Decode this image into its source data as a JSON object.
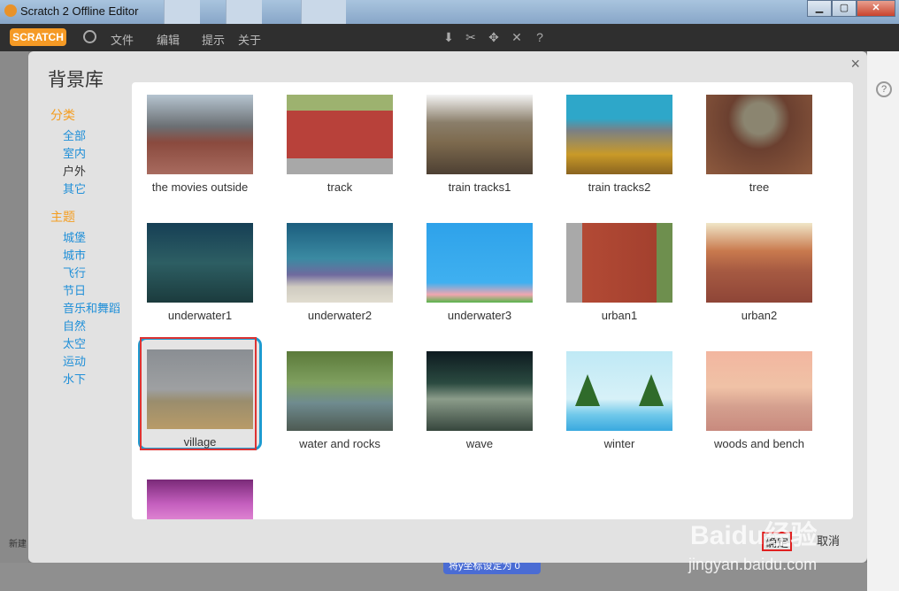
{
  "window": {
    "title": "Scratch 2 Offline Editor"
  },
  "menu": {
    "logo": "SCRATCH",
    "items": [
      "文件",
      "编辑",
      "提示",
      "关于"
    ]
  },
  "background_ui": {
    "new_label": "新建",
    "block_label": "将y坐标设定为",
    "block_value": "0"
  },
  "dialog": {
    "title": "背景库",
    "close": "×",
    "category_head": "分类",
    "categories": [
      "全部",
      "室内",
      "户外",
      "其它"
    ],
    "theme_head": "主题",
    "themes": [
      "城堡",
      "城市",
      "飞行",
      "节日",
      "音乐和舞蹈",
      "自然",
      "太空",
      "运动",
      "水下"
    ],
    "ok": "确定",
    "cancel": "取消"
  },
  "backdrops": [
    "the movies outside",
    "track",
    "train tracks1",
    "train tracks2",
    "tree",
    "underwater1",
    "underwater2",
    "underwater3",
    "urban1",
    "urban2",
    "village",
    "water and rocks",
    "wave",
    "winter",
    "woods and bench"
  ],
  "selected_backdrop": "village",
  "watermark": {
    "text": "Baidu经验",
    "sub": "jingyan.baidu.com"
  },
  "colors": {
    "accent": "#1d9bd1",
    "category_head": "#f49d20",
    "link": "#1f8fd8",
    "highlight": "#e02020"
  }
}
